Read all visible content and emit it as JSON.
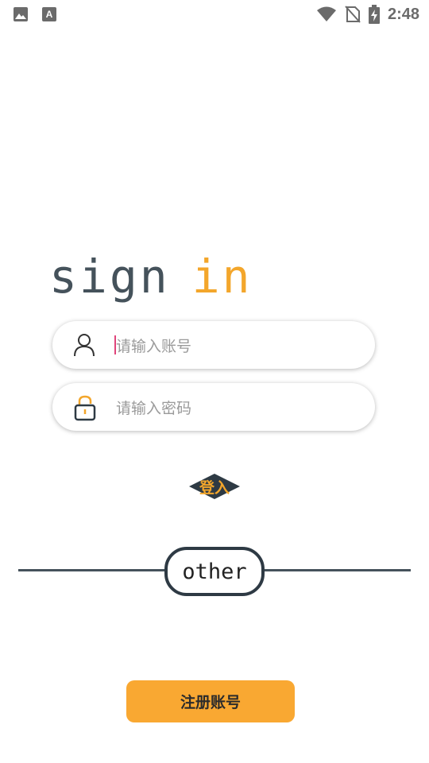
{
  "status_bar": {
    "time": "2:48",
    "left_icons": [
      "image-icon",
      "font-icon"
    ],
    "right_icons": [
      "wifi-icon",
      "no-sim-icon",
      "battery-charging-icon"
    ]
  },
  "brand": {
    "word1": "sign",
    "word2": "in",
    "colors": {
      "sign": "#45525b",
      "in": "#f3a62b"
    }
  },
  "username": {
    "placeholder": "请输入账号",
    "icon": "user-icon"
  },
  "password": {
    "placeholder": "请输入密码",
    "icon": "lock-icon"
  },
  "login": {
    "label": "登入",
    "bg": "#2e3a44",
    "text_color": "#f3a62b"
  },
  "other": {
    "label": "other"
  },
  "register": {
    "label": "注册账号",
    "bg": "#f9a832"
  }
}
